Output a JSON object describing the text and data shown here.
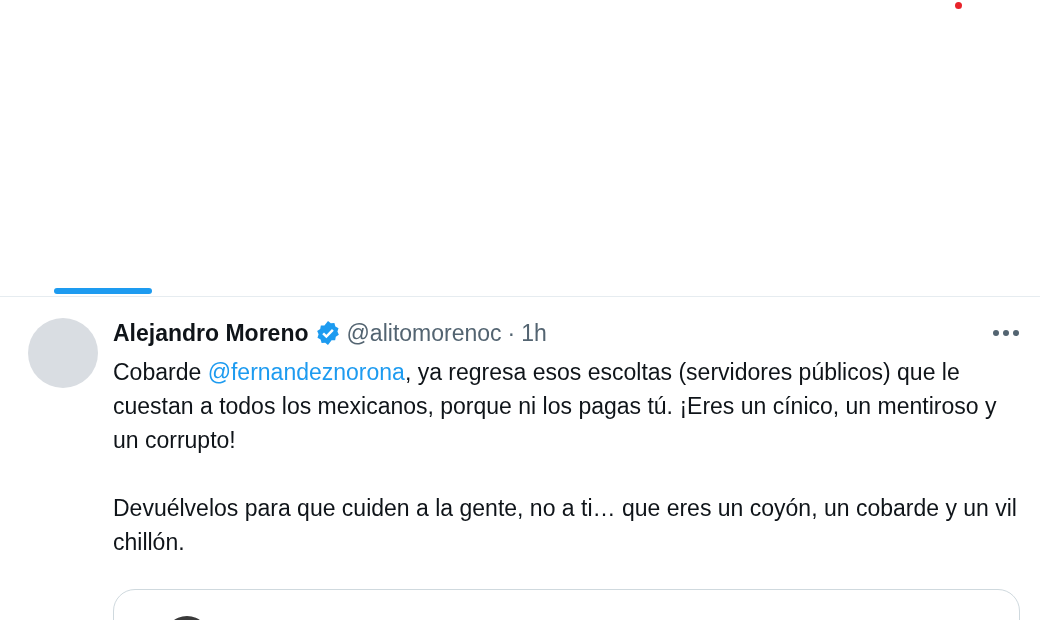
{
  "tweet": {
    "author": {
      "name": "Alejandro Moreno",
      "verified": true,
      "handle": "@alitomorenoc",
      "separator": "·",
      "time": "1h"
    },
    "paragraphs": [
      [
        {
          "kind": "text",
          "text": "Cobarde "
        },
        {
          "kind": "mention",
          "text": "@fernandeznorona"
        },
        {
          "kind": "text",
          "text": ", ya regresa esos escoltas (servidores públicos) que le cuestan a todos los mexicanos, porque ni los pagas tú. ¡Eres un cínico, un mentiroso y un corrupto!"
        }
      ],
      [
        {
          "kind": "text",
          "text": "Devuélvelos para que cuiden a la gente, no a ti… que eres un coyón, un cobarde y un vil chillón."
        }
      ]
    ]
  }
}
